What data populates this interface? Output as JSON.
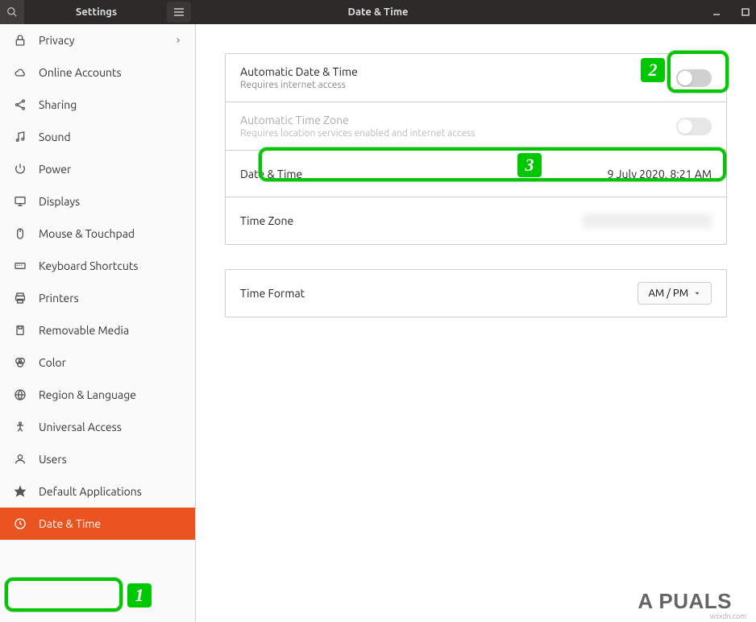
{
  "titlebar": {
    "left_title": "Settings",
    "center_title": "Date & Time"
  },
  "sidebar": {
    "items": [
      {
        "label": "Privacy",
        "icon": "lock",
        "has_chevron": true
      },
      {
        "label": "Online Accounts",
        "icon": "cloud"
      },
      {
        "label": "Sharing",
        "icon": "share"
      },
      {
        "label": "Sound",
        "icon": "music"
      },
      {
        "label": "Power",
        "icon": "power"
      },
      {
        "label": "Displays",
        "icon": "display"
      },
      {
        "label": "Mouse & Touchpad",
        "icon": "mouse"
      },
      {
        "label": "Keyboard Shortcuts",
        "icon": "keyboard"
      },
      {
        "label": "Printers",
        "icon": "printer"
      },
      {
        "label": "Removable Media",
        "icon": "media"
      },
      {
        "label": "Color",
        "icon": "color"
      },
      {
        "label": "Region & Language",
        "icon": "globe"
      },
      {
        "label": "Universal Access",
        "icon": "accessibility"
      },
      {
        "label": "Users",
        "icon": "user"
      },
      {
        "label": "Default Applications",
        "icon": "star"
      },
      {
        "label": "Date & Time",
        "icon": "clock",
        "active": true
      }
    ]
  },
  "main": {
    "auto_datetime": {
      "title": "Automatic Date & Time",
      "sub": "Requires internet access"
    },
    "auto_timezone": {
      "title": "Automatic Time Zone",
      "sub": "Requires location services enabled and internet access"
    },
    "datetime": {
      "title": "Date & Time",
      "value": "9 July 2020,  8:21 AM"
    },
    "timezone": {
      "title": "Time Zone"
    },
    "timeformat": {
      "title": "Time Format",
      "value": "AM / PM"
    }
  },
  "annotations": {
    "b1": "1",
    "b2": "2",
    "b3": "3"
  },
  "watermark": {
    "main": "A  PUALS",
    "sub": "wsxdn.com"
  }
}
